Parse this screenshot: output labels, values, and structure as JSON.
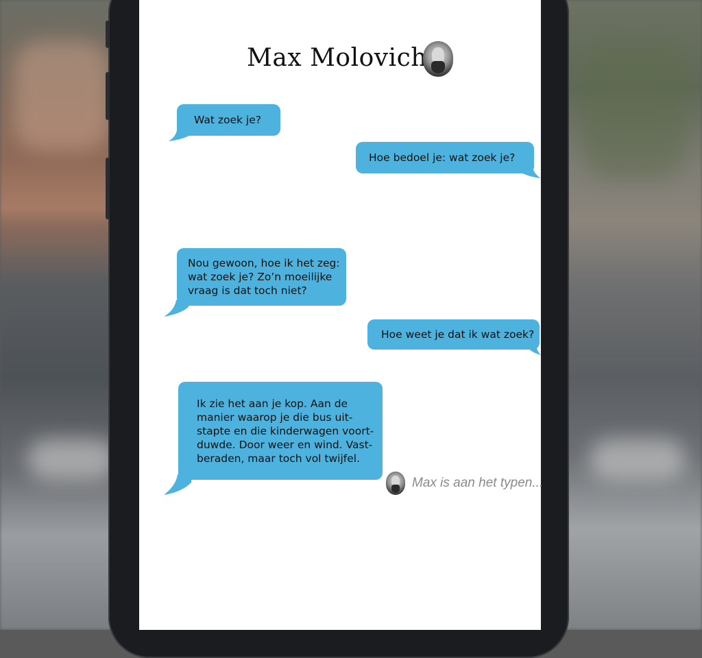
{
  "app": {
    "contact_name": "Max Molovich",
    "accent_color": "#4db3de"
  },
  "messages": [
    {
      "sender": "contact",
      "text": "Wat zoek je?"
    },
    {
      "sender": "me",
      "text": "Hoe bedoel je: wat zoek je?"
    },
    {
      "sender": "contact",
      "text": "Nou gewoon, hoe ik het zeg:\nwat zoek je? Zo’n moeilijke\nvraag is dat toch niet?"
    },
    {
      "sender": "me",
      "text": "Hoe weet je dat ik wat zoek?"
    },
    {
      "sender": "contact",
      "text": "Ik zie het aan je kop. Aan de\nmanier waarop je die bus uit-\nstapte en die kinderwagen voort-\nduwde. Door weer en wind. Vast-\nberaden, maar toch vol twijfel."
    }
  ],
  "typing_indicator": {
    "text": "Max is aan het typen..."
  },
  "icons": {
    "header_avatar": "contact-avatar-icon",
    "typing_avatar": "contact-avatar-icon"
  }
}
